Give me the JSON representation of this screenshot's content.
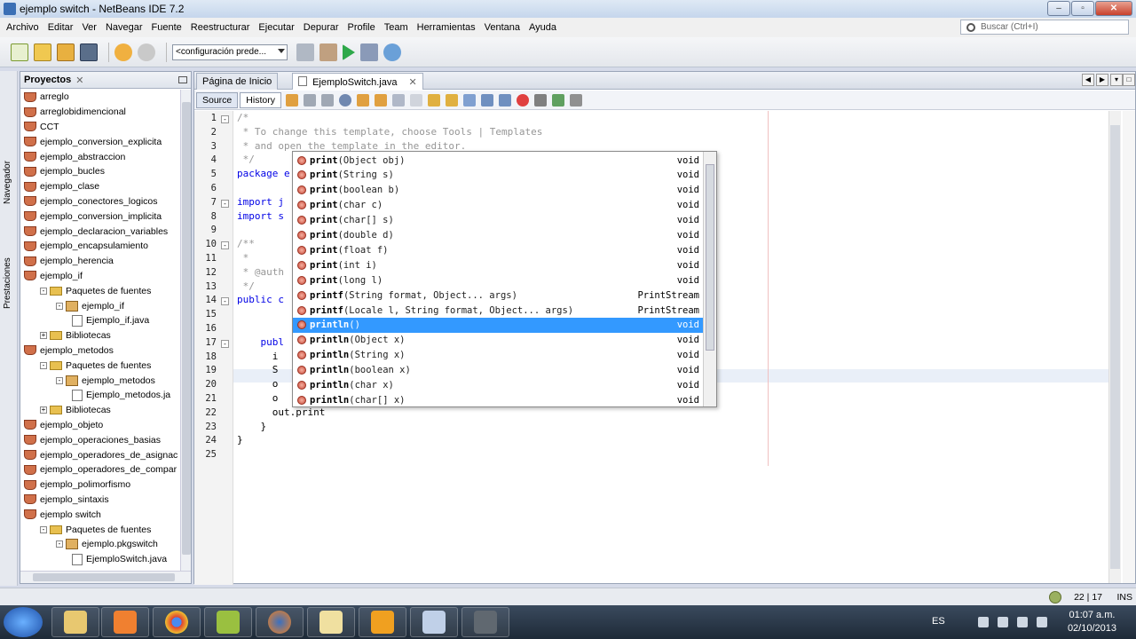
{
  "window": {
    "title": "ejemplo switch - NetBeans IDE 7.2",
    "min": "–",
    "max": "▫",
    "close": "✕"
  },
  "menu": [
    "Archivo",
    "Editar",
    "Ver",
    "Navegar",
    "Fuente",
    "Reestructurar",
    "Ejecutar",
    "Depurar",
    "Profile",
    "Team",
    "Herramientas",
    "Ventana",
    "Ayuda"
  ],
  "search": {
    "placeholder": "Buscar (Ctrl+I)"
  },
  "toolbar": {
    "config": "<configuración prede..."
  },
  "side_strip": {
    "navigator": "Navegador",
    "services": "Prestaciones"
  },
  "projects": {
    "title": "Proyectos",
    "close": "✕",
    "items": [
      {
        "label": "arreglo",
        "level": 0,
        "type": "project"
      },
      {
        "label": "arreglobidimencional",
        "level": 0,
        "type": "project"
      },
      {
        "label": "CCT",
        "level": 0,
        "type": "project"
      },
      {
        "label": "ejemplo_conversion_explicita",
        "level": 0,
        "type": "project"
      },
      {
        "label": "ejemplo_abstraccion",
        "level": 0,
        "type": "project"
      },
      {
        "label": "ejemplo_bucles",
        "level": 0,
        "type": "project"
      },
      {
        "label": "ejemplo_clase",
        "level": 0,
        "type": "project"
      },
      {
        "label": "ejemplo_conectores_logicos",
        "level": 0,
        "type": "project"
      },
      {
        "label": "ejemplo_conversion_implicita",
        "level": 0,
        "type": "project"
      },
      {
        "label": "ejemplo_declaracion_variables",
        "level": 0,
        "type": "project"
      },
      {
        "label": "ejemplo_encapsulamiento",
        "level": 0,
        "type": "project"
      },
      {
        "label": "ejemplo_herencia",
        "level": 0,
        "type": "project"
      },
      {
        "label": "ejemplo_if",
        "level": 0,
        "type": "project"
      },
      {
        "label": "Paquetes de fuentes",
        "level": 1,
        "type": "folder"
      },
      {
        "label": "ejemplo_if",
        "level": 2,
        "type": "package"
      },
      {
        "label": "Ejemplo_if.java",
        "level": 3,
        "type": "file"
      },
      {
        "label": "Bibliotecas",
        "level": 1,
        "type": "folder"
      },
      {
        "label": "ejemplo_metodos",
        "level": 0,
        "type": "project"
      },
      {
        "label": "Paquetes de fuentes",
        "level": 1,
        "type": "folder"
      },
      {
        "label": "ejemplo_metodos",
        "level": 2,
        "type": "package"
      },
      {
        "label": "Ejemplo_metodos.ja",
        "level": 3,
        "type": "file"
      },
      {
        "label": "Bibliotecas",
        "level": 1,
        "type": "folder"
      },
      {
        "label": "ejemplo_objeto",
        "level": 0,
        "type": "project"
      },
      {
        "label": "ejemplo_operaciones_basias",
        "level": 0,
        "type": "project"
      },
      {
        "label": "ejemplo_operadores_de_asignac",
        "level": 0,
        "type": "project"
      },
      {
        "label": "ejemplo_operadores_de_compar",
        "level": 0,
        "type": "project"
      },
      {
        "label": "ejemplo_polimorfismo",
        "level": 0,
        "type": "project"
      },
      {
        "label": "ejemplo_sintaxis",
        "level": 0,
        "type": "project"
      },
      {
        "label": "ejemplo switch",
        "level": 0,
        "type": "project"
      },
      {
        "label": "Paquetes de fuentes",
        "level": 1,
        "type": "folder"
      },
      {
        "label": "ejemplo.pkgswitch",
        "level": 2,
        "type": "package"
      },
      {
        "label": "EjemploSwitch.java",
        "level": 3,
        "type": "file"
      }
    ]
  },
  "tabs": [
    {
      "label": "Página de Inicio",
      "active": false
    },
    {
      "label": "EjemploSwitch.java",
      "active": true
    }
  ],
  "editor_toolbar": {
    "source": "Source",
    "history": "History"
  },
  "code": [
    {
      "n": "1",
      "text": "/*",
      "cls": "cmt",
      "indent": 0
    },
    {
      "n": "2",
      "text": " * To change this template, choose Tools | Templates",
      "cls": "cmt",
      "indent": 0
    },
    {
      "n": "3",
      "text": " * and open the template in the editor.",
      "cls": "cmt",
      "indent": 0
    },
    {
      "n": "4",
      "text": " */",
      "cls": "cmt",
      "indent": 0
    },
    {
      "n": "5",
      "text": "package e",
      "cls": "kw",
      "indent": 0
    },
    {
      "n": "6",
      "text": "",
      "cls": "",
      "indent": 0
    },
    {
      "n": "7",
      "text": "import j",
      "cls": "kw",
      "indent": 0
    },
    {
      "n": "8",
      "text": "import s",
      "cls": "kw",
      "indent": 0
    },
    {
      "n": "9",
      "text": "",
      "cls": "",
      "indent": 0
    },
    {
      "n": "10",
      "text": "/**",
      "cls": "cmt",
      "indent": 0
    },
    {
      "n": "11",
      "text": " *",
      "cls": "cmt",
      "indent": 0
    },
    {
      "n": "12",
      "text": " * @auth",
      "cls": "cmt",
      "indent": 0
    },
    {
      "n": "13",
      "text": " */",
      "cls": "cmt",
      "indent": 0
    },
    {
      "n": "14",
      "text": "public c",
      "cls": "kw",
      "indent": 0
    },
    {
      "n": "15",
      "text": "",
      "cls": "",
      "indent": 0
    },
    {
      "n": "16",
      "text": "",
      "cls": "",
      "indent": 0
    },
    {
      "n": "17",
      "text": "    publ",
      "cls": "kw",
      "indent": 0
    },
    {
      "n": "18",
      "text": "      i",
      "cls": "",
      "indent": 0
    },
    {
      "n": "19",
      "text": "      S",
      "cls": "",
      "indent": 0
    },
    {
      "n": "20",
      "text": "      o",
      "cls": "",
      "indent": 0
    },
    {
      "n": "21",
      "text": "      o",
      "cls": "",
      "indent": 0
    },
    {
      "n": "22",
      "text": "      out.print",
      "cls": "",
      "indent": 0
    },
    {
      "n": "23",
      "text": "    }",
      "cls": "",
      "indent": 0
    },
    {
      "n": "24",
      "text": "}",
      "cls": "",
      "indent": 0
    },
    {
      "n": "25",
      "text": "",
      "cls": "",
      "indent": 0
    }
  ],
  "completion": [
    {
      "name": "print",
      "params": "(Object obj)",
      "ret": "void",
      "selected": false
    },
    {
      "name": "print",
      "params": "(String s)",
      "ret": "void",
      "selected": false
    },
    {
      "name": "print",
      "params": "(boolean b)",
      "ret": "void",
      "selected": false
    },
    {
      "name": "print",
      "params": "(char c)",
      "ret": "void",
      "selected": false
    },
    {
      "name": "print",
      "params": "(char[] s)",
      "ret": "void",
      "selected": false
    },
    {
      "name": "print",
      "params": "(double d)",
      "ret": "void",
      "selected": false
    },
    {
      "name": "print",
      "params": "(float f)",
      "ret": "void",
      "selected": false
    },
    {
      "name": "print",
      "params": "(int i)",
      "ret": "void",
      "selected": false
    },
    {
      "name": "print",
      "params": "(long l)",
      "ret": "void",
      "selected": false
    },
    {
      "name": "printf",
      "params": "(String format, Object... args)",
      "ret": "PrintStream",
      "selected": false
    },
    {
      "name": "printf",
      "params": "(Locale l, String format, Object... args)",
      "ret": "PrintStream",
      "selected": false
    },
    {
      "name": "println",
      "params": "()",
      "ret": "void",
      "selected": true
    },
    {
      "name": "println",
      "params": "(Object x)",
      "ret": "void",
      "selected": false
    },
    {
      "name": "println",
      "params": "(String x)",
      "ret": "void",
      "selected": false
    },
    {
      "name": "println",
      "params": "(boolean x)",
      "ret": "void",
      "selected": false
    },
    {
      "name": "println",
      "params": "(char x)",
      "ret": "void",
      "selected": false
    },
    {
      "name": "println",
      "params": "(char[] x)",
      "ret": "void",
      "selected": false
    }
  ],
  "status": {
    "position": "22 | 17",
    "mode": "INS"
  },
  "taskbar": {
    "lang": "ES",
    "time": "01:07 a.m.",
    "date": "02/10/2013"
  },
  "colors": {
    "accent": "#3399ff",
    "keyword": "#0000e6",
    "comment": "#969696"
  }
}
